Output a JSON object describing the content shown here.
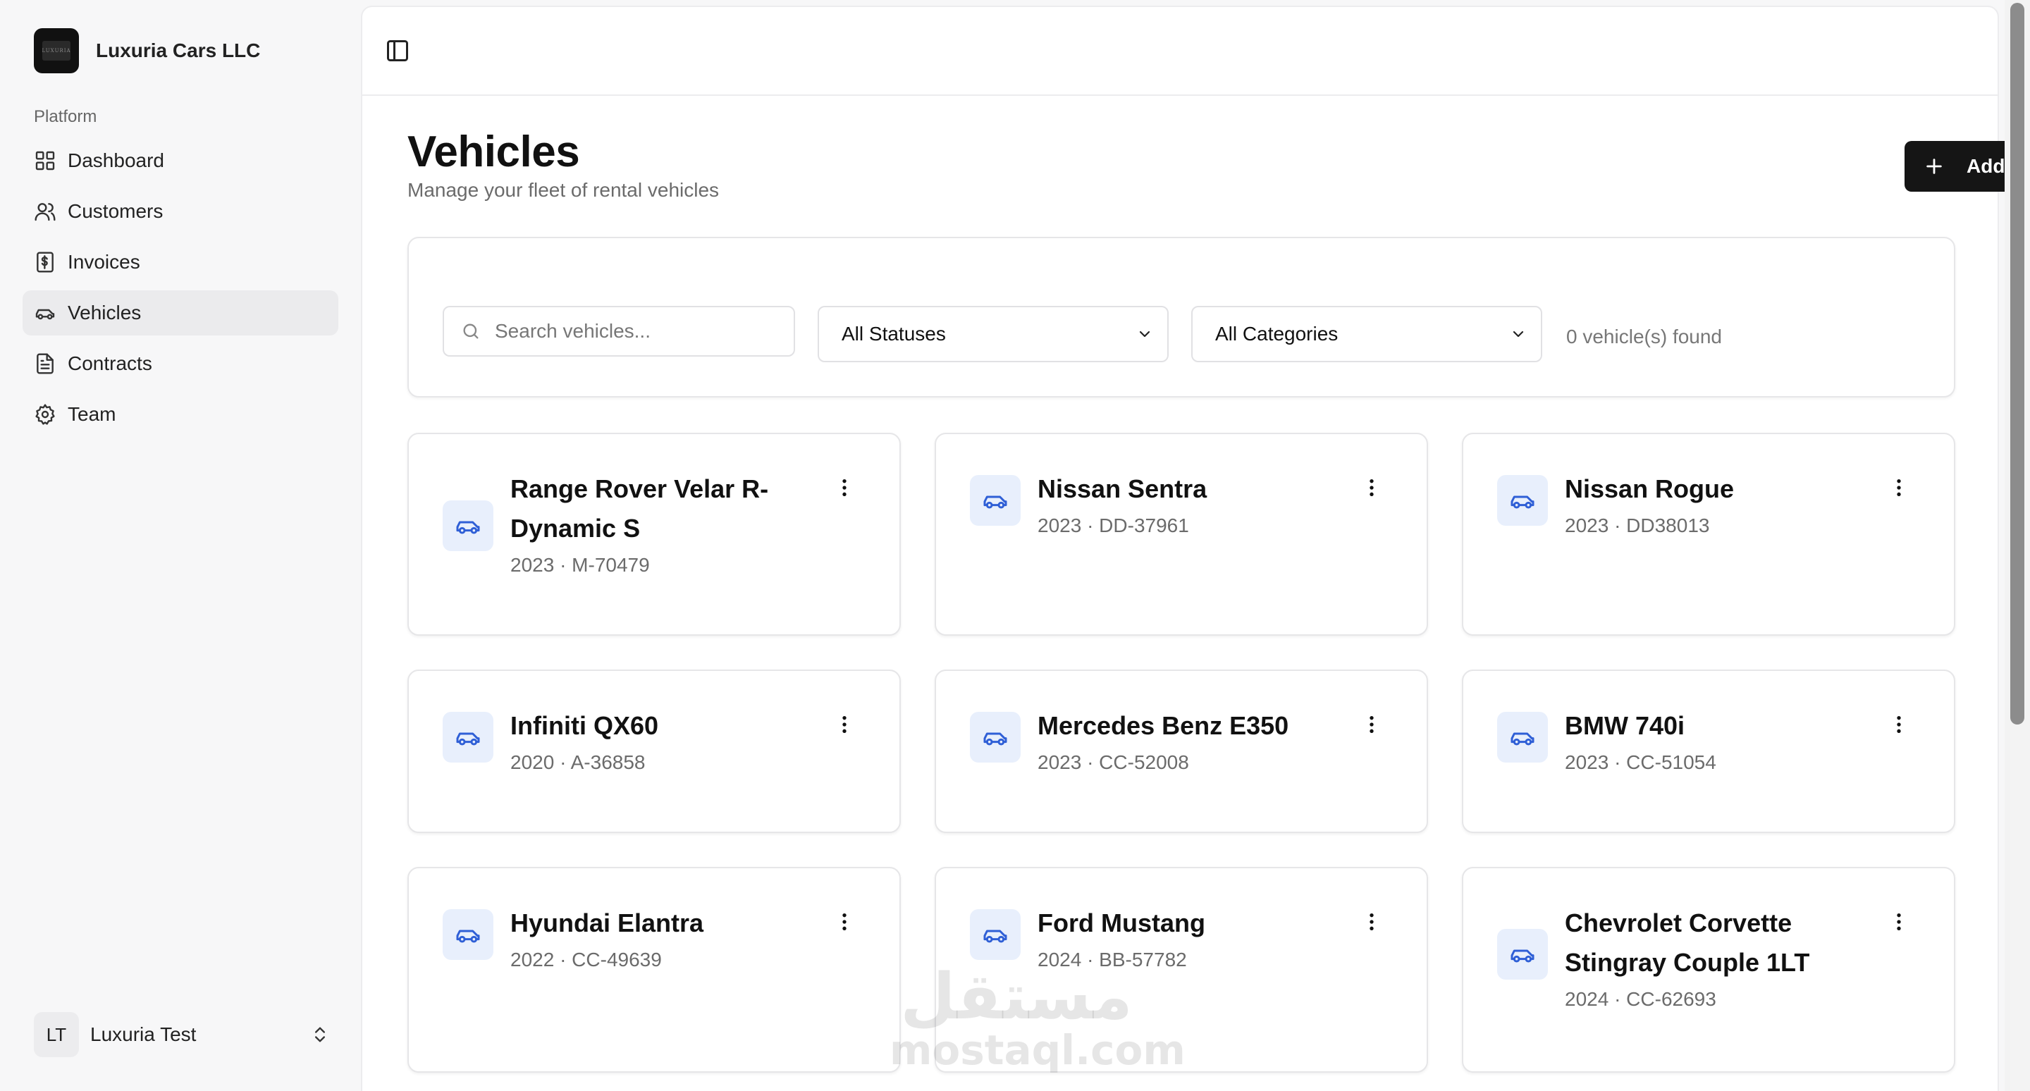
{
  "brand": {
    "name": "Luxuria Cars LLC",
    "logo_text": "LUXURIA"
  },
  "sidebar": {
    "section_label": "Platform",
    "items": [
      {
        "label": "Dashboard",
        "icon": "dashboard-icon"
      },
      {
        "label": "Customers",
        "icon": "users-icon"
      },
      {
        "label": "Invoices",
        "icon": "invoice-icon"
      },
      {
        "label": "Vehicles",
        "icon": "car-icon",
        "active": true
      },
      {
        "label": "Contracts",
        "icon": "file-icon"
      },
      {
        "label": "Team",
        "icon": "gear-icon"
      }
    ],
    "user": {
      "initials": "LT",
      "name": "Luxuria Test"
    }
  },
  "header": {
    "toggle_icon": "sidebar-toggle-icon"
  },
  "page": {
    "title": "Vehicles",
    "subtitle": "Manage your fleet of rental vehicles",
    "add_button_label": "Add Vehicle"
  },
  "filters": {
    "search_placeholder": "Search vehicles...",
    "status_selected": "All Statuses",
    "category_selected": "All Categories",
    "count_text": "0 vehicle(s) found"
  },
  "vehicles": [
    {
      "name": "Range Rover Velar R-Dynamic S",
      "meta": "2023 · M-70479"
    },
    {
      "name": "Nissan Sentra",
      "meta": "2023 · DD-37961"
    },
    {
      "name": "Nissan Rogue",
      "meta": "2023 · DD38013"
    },
    {
      "name": "Infiniti QX60",
      "meta": "2020 · A-36858"
    },
    {
      "name": "Mercedes Benz E350",
      "meta": "2023 · CC-52008"
    },
    {
      "name": "BMW 740i",
      "meta": "2023 · CC-51054"
    },
    {
      "name": "Hyundai Elantra",
      "meta": "2022 · CC-49639"
    },
    {
      "name": "Ford Mustang",
      "meta": "2024 · BB-57782"
    },
    {
      "name": "Chevrolet Corvette Stingray Couple 1LT",
      "meta": "2024 · CC-62693"
    }
  ],
  "watermark": {
    "arabic": "مستقل",
    "latin": "mostaql.com"
  },
  "colors": {
    "accent": "#2f5fd6",
    "icon_bg": "#e8effc",
    "primary_button": "#151515"
  }
}
